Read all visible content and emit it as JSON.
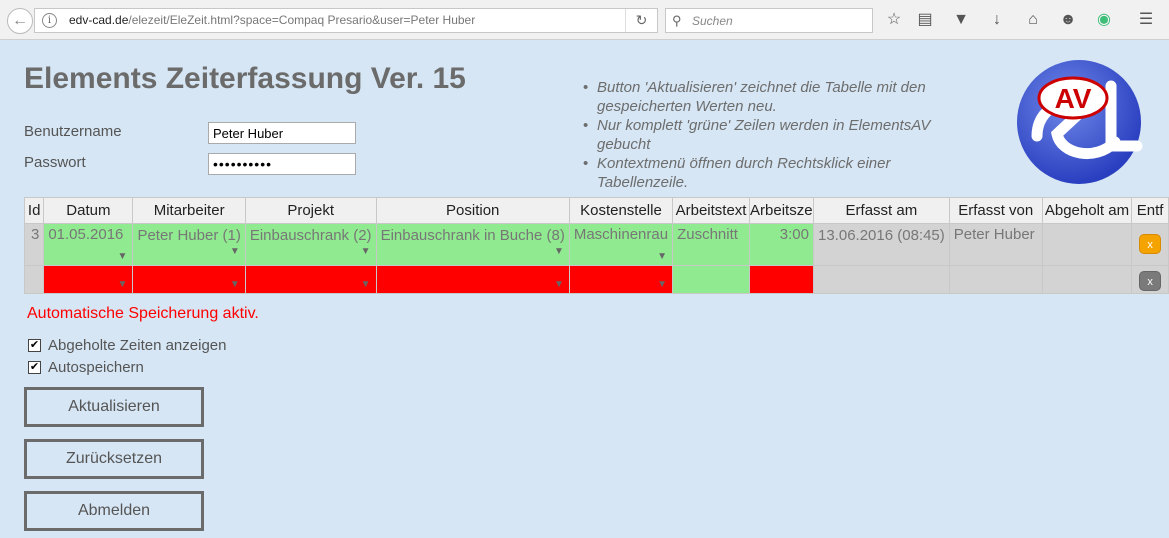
{
  "browser": {
    "url_host": "edv-cad.de",
    "url_path": "/elezeit/EleZeit.html?space=Compaq Presario&user=Peter Huber",
    "search_placeholder": "Suchen"
  },
  "page": {
    "title": "Elements Zeiterfassung Ver. 15",
    "username_label": "Benutzername",
    "username_value": "Peter Huber",
    "password_label": "Passwort",
    "password_value": "••••••••••",
    "hints": [
      "Button 'Aktualisieren' zeichnet die Tabelle mit den gespeicherten Werten neu.",
      "Nur komplett 'grüne' Zeilen werden in ElementsAV gebucht",
      "Kontextmenü öffnen durch Rechtsklick einer Tabellenzeile."
    ],
    "logo_text": "AV"
  },
  "table": {
    "headers": [
      "Id",
      "Datum",
      "Mitarbeiter",
      "Projekt",
      "Position",
      "Kostenstelle",
      "Arbeitstext",
      "Arbeitsze",
      "Erfasst am",
      "Erfasst von",
      "Abgeholt am",
      "Entf"
    ],
    "rows": [
      {
        "id": "3",
        "datum": "01.05.2016",
        "mitarbeiter": "Peter Huber (1)",
        "projekt": "Einbauschrank (2)",
        "position": "Einbauschrank in Buche (8)",
        "kostenstelle": "Maschinenrau",
        "arbeitstext": "Zuschnitt",
        "arbeitszeit": "3:00",
        "erfasst_am": "13.06.2016 (08:45)",
        "erfasst_von": "Peter Huber",
        "abgeholt_am": "",
        "entf": "x"
      },
      {
        "id": "",
        "datum": "",
        "mitarbeiter": "",
        "projekt": "",
        "position": "",
        "kostenstelle": "",
        "arbeitstext": "",
        "arbeitszeit": "",
        "erfasst_am": "",
        "erfasst_von": "",
        "abgeholt_am": "",
        "entf": "x"
      }
    ]
  },
  "status_text": "Automatische Speicherung aktiv.",
  "options": [
    {
      "label": "Abgeholte Zeiten anzeigen",
      "checked": true
    },
    {
      "label": "Autospeichern",
      "checked": true
    }
  ],
  "buttons": {
    "refresh": "Aktualisieren",
    "reset": "Zurücksetzen",
    "logout": "Abmelden"
  },
  "colors": {
    "complete_cell": "#90ea90",
    "missing_cell": "#ff0000",
    "status_text": "#ff0000",
    "delete_active": "#f5a300"
  }
}
